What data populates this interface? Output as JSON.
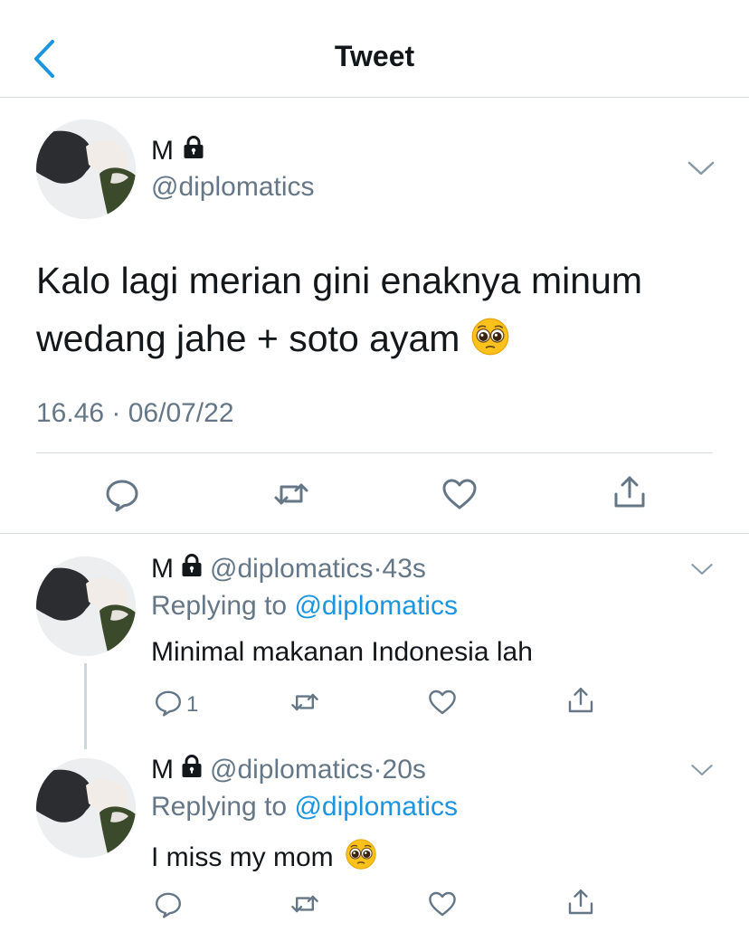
{
  "header": {
    "title": "Tweet"
  },
  "colors": {
    "accent": "#1b95e0",
    "secondary_text": "#657786",
    "divider": "#d8dde2"
  },
  "main_tweet": {
    "name": "M",
    "handle": "@diplomatics",
    "text": "Kalo lagi merian gini enaknya minum wedang jahe + soto ayam",
    "time": "16.46 · 06/07/22"
  },
  "replies": [
    {
      "name": "M",
      "handle": "@diplomatics",
      "dot": "·",
      "time": "43s",
      "replying_prefix": "Replying to",
      "replying_to": "@diplomatics",
      "text": "Minimal makanan Indonesia lah",
      "reply_count": "1"
    },
    {
      "name": "M",
      "handle": "@diplomatics",
      "dot": "·",
      "time": "20s",
      "replying_prefix": "Replying to",
      "replying_to": "@diplomatics",
      "text": "I miss my mom"
    }
  ]
}
